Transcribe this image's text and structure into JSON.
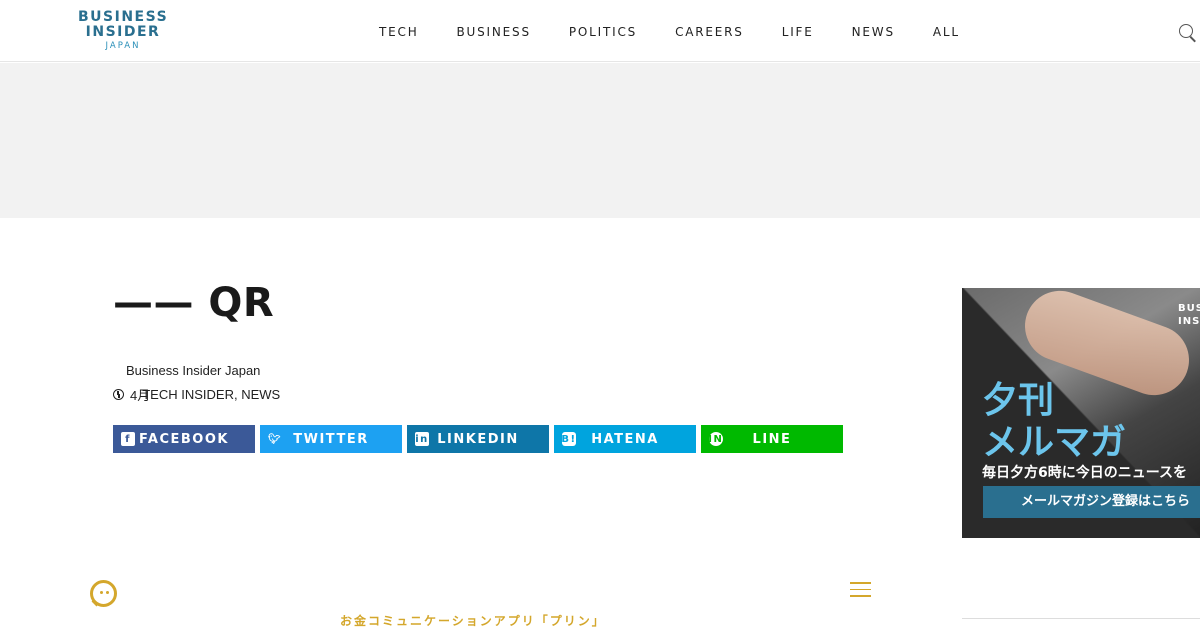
{
  "header": {
    "logo": {
      "line1": "BUSINESS",
      "line2": "INSIDER",
      "line3": "JAPAN"
    },
    "nav": [
      "TECH",
      "BUSINESS",
      "POLITICS",
      "CAREERS",
      "LIFE",
      "NEWS",
      "ALL"
    ]
  },
  "article": {
    "title": "—— QR",
    "author": "Business Insider Japan",
    "meta": "4月",
    "categories": "TECH INSIDER, NEWS"
  },
  "share": {
    "facebook": "FACEBOOK",
    "twitter": "TWITTER",
    "linkedin": "LINKEDIN",
    "hatena": "HATENA",
    "line": "LINE"
  },
  "side_ad": {
    "brand": "BUSINESS INSIDER",
    "headline_line1": "夕刊",
    "headline_line2": "メルマガ",
    "sub": "毎日夕方6時に今日のニュースを",
    "cta": "メールマガジン登録はこちら"
  },
  "footer": {
    "promo_text": "お金コミュニケーションアプリ「プリン」"
  },
  "colors": {
    "brand": "#2a6f8f",
    "facebook": "#3b5998",
    "twitter": "#1da1f2",
    "linkedin": "#0e76a8",
    "hatena": "#00a4de",
    "line": "#00b900",
    "accent_gold": "#d4a72c"
  }
}
